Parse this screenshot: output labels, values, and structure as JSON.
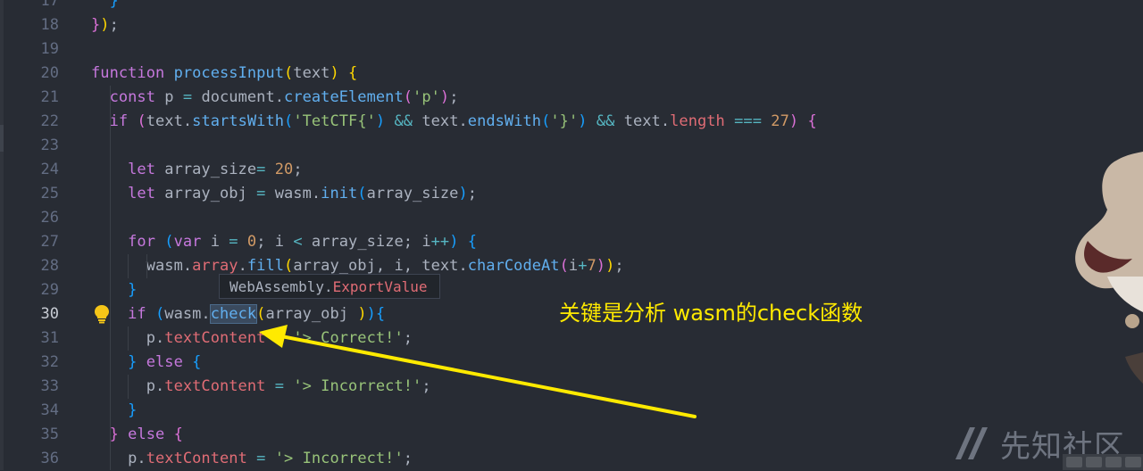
{
  "editor": {
    "lines": [
      {
        "n": "17",
        "tokens": [
          [
            "pl",
            "  "
          ],
          [
            "br3",
            "}"
          ]
        ]
      },
      {
        "n": "18",
        "tokens": [
          [
            "br2",
            "}"
          ],
          [
            "br1",
            ")"
          ],
          [
            "pl",
            ";"
          ]
        ]
      },
      {
        "n": "19",
        "tokens": []
      },
      {
        "n": "20",
        "tokens": [
          [
            "kw",
            "function "
          ],
          [
            "fn",
            "processInput"
          ],
          [
            "br1",
            "("
          ],
          [
            "pl",
            "text"
          ],
          [
            "br1",
            ")"
          ],
          [
            "pl",
            " "
          ],
          [
            "br1",
            "{"
          ]
        ]
      },
      {
        "n": "21",
        "tokens": [
          [
            "pl",
            "  "
          ],
          [
            "kw",
            "const "
          ],
          [
            "pl",
            "p "
          ],
          [
            "op",
            "="
          ],
          [
            "pl",
            " document."
          ],
          [
            "fn",
            "createElement"
          ],
          [
            "br2",
            "("
          ],
          [
            "str",
            "'p'"
          ],
          [
            "br2",
            ")"
          ],
          [
            "pl",
            ";"
          ]
        ]
      },
      {
        "n": "22",
        "tokens": [
          [
            "pl",
            "  "
          ],
          [
            "kw",
            "if "
          ],
          [
            "br2",
            "("
          ],
          [
            "pl",
            "text."
          ],
          [
            "fn",
            "startsWith"
          ],
          [
            "br3",
            "("
          ],
          [
            "str",
            "'TetCTF{'"
          ],
          [
            "br3",
            ")"
          ],
          [
            "pl",
            " "
          ],
          [
            "op",
            "&&"
          ],
          [
            "pl",
            " text."
          ],
          [
            "fn",
            "endsWith"
          ],
          [
            "br3",
            "("
          ],
          [
            "str",
            "'}'"
          ],
          [
            "br3",
            ")"
          ],
          [
            "pl",
            " "
          ],
          [
            "op",
            "&&"
          ],
          [
            "pl",
            " text."
          ],
          [
            "prop",
            "length"
          ],
          [
            "pl",
            " "
          ],
          [
            "op",
            "==="
          ],
          [
            "pl",
            " "
          ],
          [
            "num",
            "27"
          ],
          [
            "br2",
            ")"
          ],
          [
            "pl",
            " "
          ],
          [
            "br2",
            "{"
          ]
        ]
      },
      {
        "n": "23",
        "tokens": []
      },
      {
        "n": "24",
        "tokens": [
          [
            "pl",
            "    "
          ],
          [
            "kw",
            "let "
          ],
          [
            "pl",
            "array_size"
          ],
          [
            "op",
            "="
          ],
          [
            "pl",
            " "
          ],
          [
            "num",
            "20"
          ],
          [
            "pl",
            ";"
          ]
        ]
      },
      {
        "n": "25",
        "tokens": [
          [
            "pl",
            "    "
          ],
          [
            "kw",
            "let "
          ],
          [
            "pl",
            "array_obj "
          ],
          [
            "op",
            "="
          ],
          [
            "pl",
            " wasm."
          ],
          [
            "fn",
            "init"
          ],
          [
            "br3",
            "("
          ],
          [
            "pl",
            "array_size"
          ],
          [
            "br3",
            ")"
          ],
          [
            "pl",
            ";"
          ]
        ]
      },
      {
        "n": "26",
        "tokens": []
      },
      {
        "n": "27",
        "tokens": [
          [
            "pl",
            "    "
          ],
          [
            "kw",
            "for "
          ],
          [
            "br3",
            "("
          ],
          [
            "kw",
            "var "
          ],
          [
            "pl",
            "i "
          ],
          [
            "op",
            "="
          ],
          [
            "pl",
            " "
          ],
          [
            "num",
            "0"
          ],
          [
            "pl",
            "; i "
          ],
          [
            "op",
            "<"
          ],
          [
            "pl",
            " array_size; i"
          ],
          [
            "op",
            "++"
          ],
          [
            "br3",
            ")"
          ],
          [
            "pl",
            " "
          ],
          [
            "br3",
            "{"
          ]
        ]
      },
      {
        "n": "28",
        "tokens": [
          [
            "pl",
            "      wasm."
          ],
          [
            "prop",
            "array"
          ],
          [
            "pl",
            "."
          ],
          [
            "fn",
            "fill"
          ],
          [
            "br1",
            "("
          ],
          [
            "pl",
            "array_obj, i, text."
          ],
          [
            "fn",
            "charCodeAt"
          ],
          [
            "br2",
            "("
          ],
          [
            "pl",
            "i"
          ],
          [
            "op",
            "+"
          ],
          [
            "num",
            "7"
          ],
          [
            "br2",
            ")"
          ],
          [
            "br1",
            ")"
          ],
          [
            "pl",
            ";"
          ]
        ]
      },
      {
        "n": "29",
        "tokens": [
          [
            "pl",
            "    "
          ],
          [
            "br3",
            "}"
          ]
        ]
      },
      {
        "n": "30",
        "tokens": [
          [
            "pl",
            "    "
          ],
          [
            "kw",
            "if "
          ],
          [
            "br3",
            "("
          ],
          [
            "pl",
            "wasm."
          ],
          [
            "fnhl",
            "check"
          ],
          [
            "br1",
            "("
          ],
          [
            "pl",
            "array_obj "
          ],
          [
            "br1",
            ")"
          ],
          [
            "br3",
            ")"
          ],
          [
            "br3",
            "{"
          ]
        ]
      },
      {
        "n": "31",
        "tokens": [
          [
            "pl",
            "      p."
          ],
          [
            "prop",
            "textContent"
          ],
          [
            "pl",
            " "
          ],
          [
            "op",
            "="
          ],
          [
            "pl",
            " "
          ],
          [
            "str",
            "'> Correct!'"
          ],
          [
            "pl",
            ";"
          ]
        ]
      },
      {
        "n": "32",
        "tokens": [
          [
            "pl",
            "    "
          ],
          [
            "br3",
            "}"
          ],
          [
            "pl",
            " "
          ],
          [
            "kw",
            "else "
          ],
          [
            "br3",
            "{"
          ]
        ]
      },
      {
        "n": "33",
        "tokens": [
          [
            "pl",
            "      p."
          ],
          [
            "prop",
            "textContent"
          ],
          [
            "pl",
            " "
          ],
          [
            "op",
            "="
          ],
          [
            "pl",
            " "
          ],
          [
            "str",
            "'> Incorrect!'"
          ],
          [
            "pl",
            ";"
          ]
        ]
      },
      {
        "n": "34",
        "tokens": [
          [
            "pl",
            "    "
          ],
          [
            "br3",
            "}"
          ]
        ]
      },
      {
        "n": "35",
        "tokens": [
          [
            "pl",
            "  "
          ],
          [
            "br2",
            "}"
          ],
          [
            "pl",
            " "
          ],
          [
            "kw",
            "else "
          ],
          [
            "br2",
            "{"
          ]
        ]
      },
      {
        "n": "36",
        "tokens": [
          [
            "pl",
            "    p."
          ],
          [
            "prop",
            "textContent"
          ],
          [
            "pl",
            " "
          ],
          [
            "op",
            "="
          ],
          [
            "pl",
            " "
          ],
          [
            "str",
            "'> Incorrect!'"
          ],
          [
            "pl",
            ";"
          ]
        ]
      }
    ],
    "active_line": "30"
  },
  "tooltip": {
    "prefix": "WebAssembly.",
    "member": "ExportValue"
  },
  "annotation": {
    "text": "关键是分析 wasm的check函数",
    "color": "#ffea00"
  },
  "watermark": {
    "text": "先知社区"
  },
  "icons": {
    "bulb": "lightbulb-icon",
    "watermark_logo": "xianzhi-logo-icon"
  }
}
